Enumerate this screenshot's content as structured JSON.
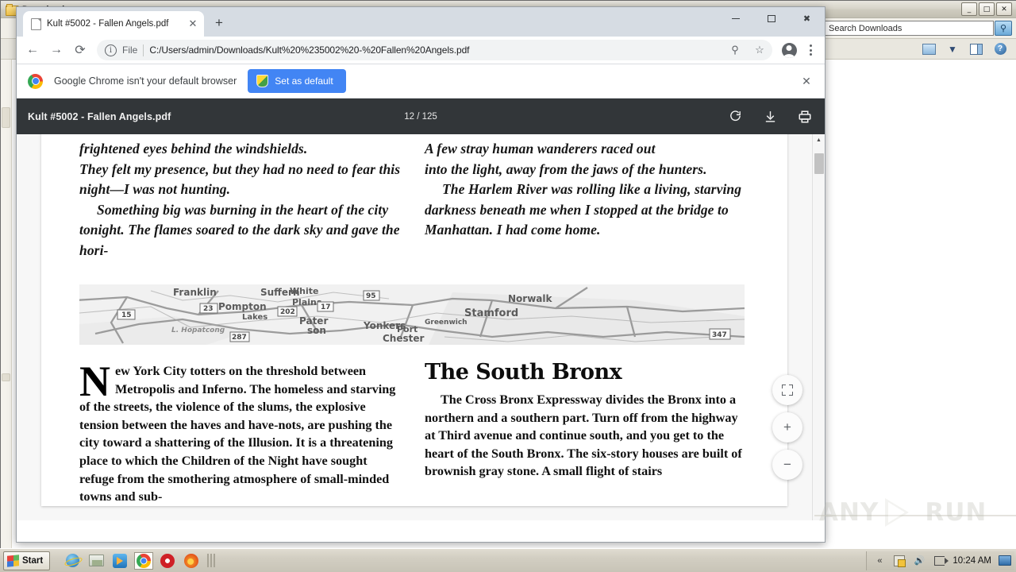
{
  "explorer": {
    "title": "Downloads",
    "search_placeholder": "Search Downloads",
    "minimize_label": "_",
    "maximize_label": "□",
    "close_label": "✕",
    "search_icon": "search-icon",
    "preview_icon": "preview-pane-icon",
    "dropdown_icon": "chevron-down-icon",
    "layout_icon": "layout-pane-icon",
    "help_icon": "help-icon"
  },
  "chrome": {
    "tab": {
      "title": "Kult #5002 - Fallen Angels.pdf",
      "close_label": "✕",
      "favicon": "page-icon"
    },
    "new_tab_label": "+",
    "window_controls": {
      "minimize": "minimize-icon",
      "maximize": "maximize-icon",
      "close": "✖"
    },
    "nav": {
      "back": "←",
      "forward": "→",
      "reload": "⟳"
    },
    "omnibox": {
      "info_label": "i",
      "scheme": "File",
      "url": "C:/Users/admin/Downloads/Kult%20%235002%20-%20Fallen%20Angels.pdf",
      "zoom_icon": "search-zoom-icon",
      "bookmark_icon": "☆"
    },
    "profile_icon": "profile-avatar-icon",
    "menu_icon": "kebab-menu-icon",
    "infobar": {
      "message": "Google Chrome isn't your default browser",
      "button_label": "Set as default",
      "close_label": "✕",
      "logo": "chrome-logo-icon",
      "shield_icon": "windows-defender-shield-icon"
    }
  },
  "pdf": {
    "document_name": "Kult #5002 - Fallen Angels.pdf",
    "page_indicator": "12 / 125",
    "rotate_icon": "rotate-clockwise-icon",
    "download_icon": "download-icon",
    "print_icon": "print-icon",
    "fit_label": "fit-to-page-icon",
    "zoom_in_label": "+",
    "zoom_out_label": "−",
    "scroll_up_label": "▲",
    "content": {
      "column_left_italic": [
        "frightened eyes behind the windshields.",
        "They felt my presence, but they had no need to fear this night—I was not hunting.",
        "Something big was burning in the heart of the city tonight. The flames soared to the dark sky and gave the hori-"
      ],
      "column_right_italic": [
        "A few stray human wanderers raced out",
        "into the light, away from the jaws of the hunters.",
        "The Harlem River was rolling like a living, starving darkness beneath me when I stopped at the bridge to Manhattan. I had come home."
      ],
      "map_labels": [
        "Franklin",
        "Suffern",
        "Pompton Lakes",
        "Paterson",
        "Yonkers",
        "L. Hopatcong",
        "White Plains",
        "Stamford",
        "Norwalk",
        "Greenwich",
        "Port Chester",
        "15",
        "23",
        "202",
        "17",
        "287",
        "95",
        "347"
      ],
      "column_left_body_dropcap": "N",
      "column_left_body": "ew York City totters on the threshold between Metropolis and Inferno. The homeless and starving of the streets, the violence of the slums, the explosive tension between the haves and have-nots, are pushing the city toward a shattering of the Illusion. It is a threatening place to which the Children of the Night have sought refuge from the smothering atmosphere of small-minded towns and sub-",
      "column_right_heading": "The South Bronx",
      "column_right_body": "The Cross Bronx Expressway divides the Bronx into a northern and a southern part. Turn off from the highway at Third avenue and continue south, and you get to the heart of the South Bronx. The six-story houses are built of brownish gray stone. A small flight of stairs"
    }
  },
  "watermark": {
    "text_left": "ANY",
    "text_right": "RUN",
    "logo": "play-triangle-icon"
  },
  "taskbar": {
    "start_label": "Start",
    "quick_launch": [
      {
        "name": "internet-explorer",
        "label": "Internet Explorer"
      },
      {
        "name": "file-explorer",
        "label": "File Explorer"
      },
      {
        "name": "windows-media-player",
        "label": "Windows Media Player"
      },
      {
        "name": "google-chrome",
        "label": "Google Chrome"
      },
      {
        "name": "opera",
        "label": "Opera"
      },
      {
        "name": "firefox",
        "label": "Mozilla Firefox"
      }
    ],
    "tray": {
      "expand_label": "«",
      "security_icon": "security-alert-icon",
      "volume_icon": "🔊",
      "network_flag_icon": "network-flag-icon",
      "time": "10:24 AM",
      "display_icon": "display-icon"
    }
  }
}
